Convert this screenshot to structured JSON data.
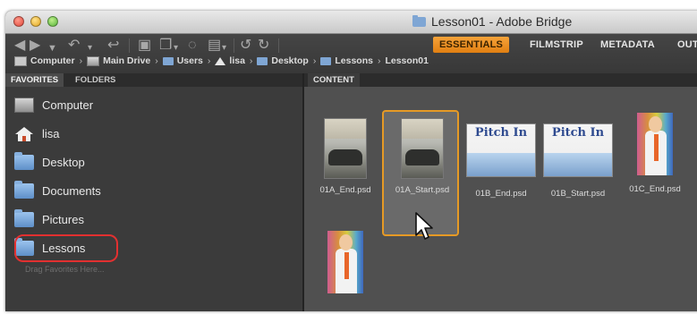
{
  "window": {
    "title": "Lesson01 - Adobe Bridge"
  },
  "toolbar": {
    "workspaces": [
      "ESSENTIALS",
      "FILMSTRIP",
      "METADATA",
      "OUT"
    ],
    "active_workspace": "ESSENTIALS"
  },
  "breadcrumb": [
    {
      "label": "Computer",
      "icon": "computer-icon"
    },
    {
      "label": "Main Drive",
      "icon": "drive-icon"
    },
    {
      "label": "Users",
      "icon": "folder-icon"
    },
    {
      "label": "lisa",
      "icon": "home-icon"
    },
    {
      "label": "Desktop",
      "icon": "folder-icon"
    },
    {
      "label": "Lessons",
      "icon": "folder-icon"
    },
    {
      "label": "Lesson01",
      "icon": ""
    }
  ],
  "left_panel": {
    "tabs": [
      "FAVORITES",
      "FOLDERS"
    ],
    "active_tab": "FAVORITES",
    "items": [
      {
        "label": "Computer",
        "icon": "computer-icon"
      },
      {
        "label": "lisa",
        "icon": "home-icon"
      },
      {
        "label": "Desktop",
        "icon": "folder-icon"
      },
      {
        "label": "Documents",
        "icon": "folder-icon"
      },
      {
        "label": "Pictures",
        "icon": "folder-icon"
      },
      {
        "label": "Lessons",
        "icon": "folder-icon"
      }
    ],
    "highlighted_item": "Lessons",
    "drag_hint": "Drag Favorites Here..."
  },
  "content_panel": {
    "tab": "CONTENT",
    "thumbnails": [
      {
        "name": "01A_End.psd",
        "kind": "car"
      },
      {
        "name": "01A_Start.psd",
        "kind": "car",
        "selected": true
      },
      {
        "name": "01B_End.psd",
        "kind": "pitch",
        "art_text": "Pitch In"
      },
      {
        "name": "01B_Start.psd",
        "kind": "pitch",
        "art_text": "Pitch In"
      },
      {
        "name": "01C_End.psd",
        "kind": "man"
      },
      {
        "name": "",
        "kind": "man"
      }
    ]
  },
  "colors": {
    "accent": "#e69a25",
    "highlight_ring": "#e23030",
    "panel_bg": "#3b3b3b",
    "content_bg": "#505050"
  }
}
